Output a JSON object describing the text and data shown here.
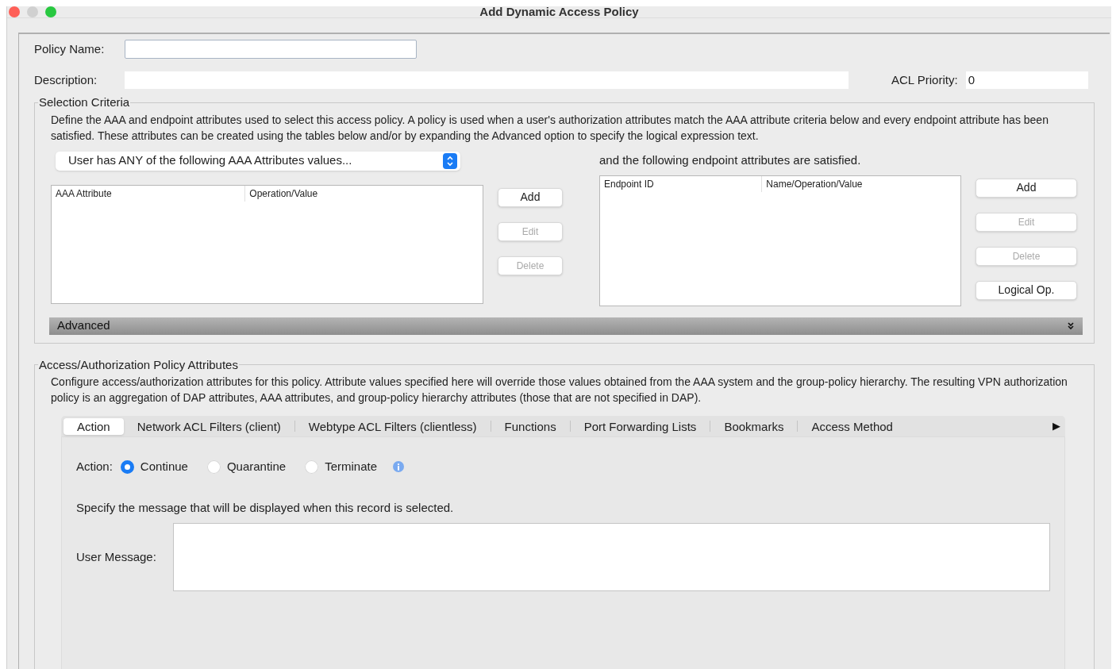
{
  "window": {
    "title": "Add Dynamic Access Policy"
  },
  "policy_name": {
    "label": "Policy Name:"
  },
  "description": {
    "label": "Description:"
  },
  "acl_priority": {
    "label": "ACL Priority:",
    "value": "0"
  },
  "selection_criteria": {
    "title": "Selection Criteria",
    "text": "Define the AAA and endpoint attributes used to select this access policy. A policy is used when a user's authorization attributes match the AAA attribute criteria below and every endpoint attribute has been satisfied. These attributes can be created using the tables below and/or by expanding the Advanced option to specify the logical expression text.",
    "aaa_select": "User has ANY of the following AAA Attributes values...",
    "aaa_table": {
      "columns": [
        "AAA Attribute",
        "Operation/Value"
      ]
    },
    "aaa_buttons": [
      {
        "label": "Add",
        "disabled": false
      },
      {
        "label": "Edit",
        "disabled": true
      },
      {
        "label": "Delete",
        "disabled": true
      }
    ],
    "endpoint_text": "and the following endpoint attributes are satisfied.",
    "endpoint_table": {
      "columns": [
        "Endpoint ID",
        "Name/Operation/Value"
      ]
    },
    "endpoint_buttons": [
      {
        "label": "Add",
        "disabled": false
      },
      {
        "label": "Edit",
        "disabled": true
      },
      {
        "label": "Delete",
        "disabled": true
      },
      {
        "label": "Logical Op.",
        "disabled": false
      }
    ],
    "advanced": {
      "label": "Advanced",
      "expanded": false
    }
  },
  "access_attributes": {
    "title": "Access/Authorization Policy Attributes",
    "text": "Configure access/authorization attributes for this policy. Attribute values specified here will override those values obtained from the AAA system and the group-policy hierarchy. The resulting VPN authorization policy is an aggregation of DAP attributes, AAA attributes, and group-policy hierarchy attributes (those that are not specified in DAP).",
    "tabs": [
      {
        "label": "Action",
        "selected": true
      },
      {
        "label": "Network ACL Filters (client)",
        "selected": false
      },
      {
        "label": "Webtype ACL Filters (clientless)",
        "selected": false
      },
      {
        "label": "Functions",
        "selected": false
      },
      {
        "label": "Port Forwarding Lists",
        "selected": false
      },
      {
        "label": "Bookmarks",
        "selected": false
      },
      {
        "label": "Access Method",
        "selected": false
      }
    ],
    "tab_scroll": "▶",
    "action_label": "Action:",
    "actions": [
      {
        "label": "Continue",
        "selected": true
      },
      {
        "label": "Quarantine",
        "selected": false
      },
      {
        "label": "Terminate",
        "selected": false
      }
    ],
    "message_hint": "Specify the message that will be displayed when this record is selected.",
    "user_message": {
      "label": "User Message:"
    }
  }
}
